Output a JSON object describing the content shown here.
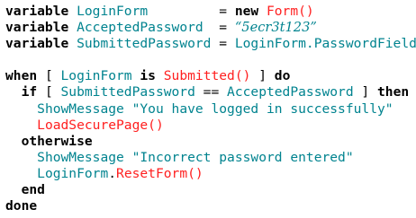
{
  "colors": {
    "keyword": "#000000",
    "identifier": "#00838f",
    "function_call": "#ff1f1f",
    "string": "#00838f",
    "background": "#ffffff"
  },
  "code": {
    "lines": [
      [
        {
          "text": "variable",
          "kind": "kw"
        },
        {
          "text": " ",
          "kind": "pl"
        },
        {
          "text": "LoginForm",
          "kind": "id"
        },
        {
          "text": "         = ",
          "kind": "pl"
        },
        {
          "text": "new",
          "kind": "kw"
        },
        {
          "text": " ",
          "kind": "pl"
        },
        {
          "text": "Form()",
          "kind": "rd"
        }
      ],
      [
        {
          "text": "variable",
          "kind": "kw"
        },
        {
          "text": " ",
          "kind": "pl"
        },
        {
          "text": "AcceptedPassword",
          "kind": "id"
        },
        {
          "text": "  = ",
          "kind": "pl"
        },
        {
          "text": "“5ecr3t123”",
          "kind": "ss"
        }
      ],
      [
        {
          "text": "variable",
          "kind": "kw"
        },
        {
          "text": " ",
          "kind": "pl"
        },
        {
          "text": "SubmittedPassword",
          "kind": "id"
        },
        {
          "text": " = ",
          "kind": "pl"
        },
        {
          "text": "LoginForm.PasswordField",
          "kind": "id"
        }
      ],
      [
        {
          "text": "",
          "kind": "pl"
        }
      ],
      [
        {
          "text": "when",
          "kind": "kw"
        },
        {
          "text": " [ ",
          "kind": "pl"
        },
        {
          "text": "LoginForm",
          "kind": "id"
        },
        {
          "text": " ",
          "kind": "pl"
        },
        {
          "text": "is",
          "kind": "kw"
        },
        {
          "text": " ",
          "kind": "pl"
        },
        {
          "text": "Submitted()",
          "kind": "rd"
        },
        {
          "text": " ] ",
          "kind": "pl"
        },
        {
          "text": "do",
          "kind": "kw"
        }
      ],
      [
        {
          "text": "  ",
          "kind": "pl"
        },
        {
          "text": "if",
          "kind": "kw"
        },
        {
          "text": " [ ",
          "kind": "pl"
        },
        {
          "text": "SubmittedPassword",
          "kind": "id"
        },
        {
          "text": " == ",
          "kind": "pl"
        },
        {
          "text": "AcceptedPassword",
          "kind": "id"
        },
        {
          "text": " ] ",
          "kind": "pl"
        },
        {
          "text": "then",
          "kind": "kw"
        }
      ],
      [
        {
          "text": "    ",
          "kind": "pl"
        },
        {
          "text": "ShowMessage",
          "kind": "id"
        },
        {
          "text": " ",
          "kind": "pl"
        },
        {
          "text": "\"You have logged in successfully\"",
          "kind": "st"
        }
      ],
      [
        {
          "text": "    ",
          "kind": "pl"
        },
        {
          "text": "LoadSecurePage()",
          "kind": "rd"
        }
      ],
      [
        {
          "text": "  ",
          "kind": "pl"
        },
        {
          "text": "otherwise",
          "kind": "kw"
        }
      ],
      [
        {
          "text": "    ",
          "kind": "pl"
        },
        {
          "text": "ShowMessage",
          "kind": "id"
        },
        {
          "text": " ",
          "kind": "pl"
        },
        {
          "text": "\"Incorrect password entered\"",
          "kind": "st"
        }
      ],
      [
        {
          "text": "    ",
          "kind": "pl"
        },
        {
          "text": "LoginForm",
          "kind": "id"
        },
        {
          "text": ".",
          "kind": "pl"
        },
        {
          "text": "ResetForm()",
          "kind": "rd"
        }
      ],
      [
        {
          "text": "  ",
          "kind": "pl"
        },
        {
          "text": "end",
          "kind": "kw"
        }
      ],
      [
        {
          "text": "done",
          "kind": "kw"
        }
      ]
    ]
  }
}
